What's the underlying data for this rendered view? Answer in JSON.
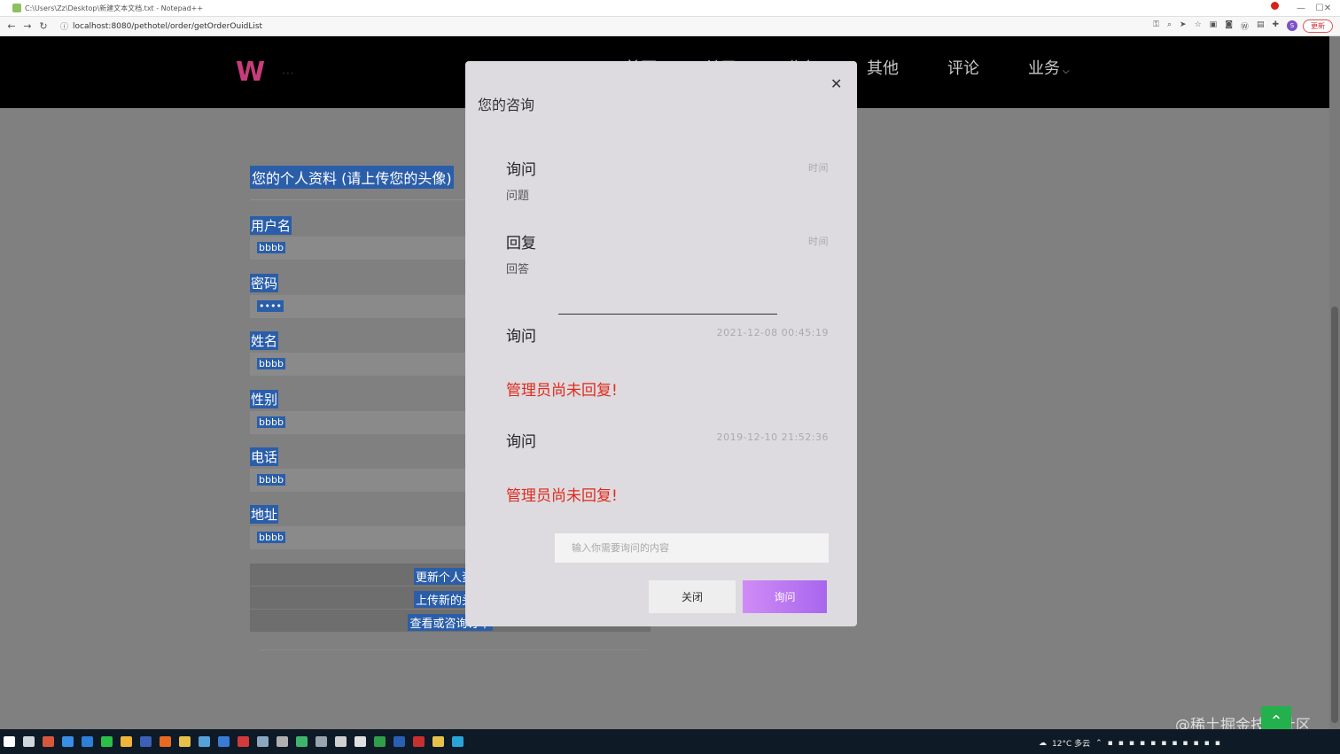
{
  "window": {
    "title": "C:\\Users\\Zz\\Desktop\\新建文本文档.txt - Notepad++",
    "minimize_icon": "minimize-icon",
    "maximize_icon": "maximize-icon",
    "close_icon": "close-icon"
  },
  "browser": {
    "url": "localhost:8080/pethotel/order/getOrderOuidList",
    "update_label": "更新",
    "profile_initial": "S"
  },
  "site": {
    "nav": [
      "首页",
      "关于",
      "业务",
      "其他",
      "评论",
      "业务"
    ]
  },
  "profile": {
    "title": "您的个人资料 (请上传您的头像)",
    "fields": [
      {
        "label": "用户名",
        "value": "bbbb"
      },
      {
        "label": "密码",
        "value": "••••"
      },
      {
        "label": "姓名",
        "value": "bbbb"
      },
      {
        "label": "性别",
        "value": "bbbb"
      },
      {
        "label": "电话",
        "value": "bbbb"
      },
      {
        "label": "地址",
        "value": "bbbb"
      }
    ],
    "buttons": [
      "更新个人资料",
      "上传新的头像",
      "查看或咨询订单"
    ]
  },
  "modal": {
    "title": "您的咨询",
    "header": {
      "ask_label": "询问",
      "ask_time_label": "时间",
      "ask_body": "问题",
      "reply_label": "回复",
      "reply_time_label": "时间",
      "reply_body": "回答"
    },
    "inquiries": [
      {
        "label": "询问",
        "time": "2021-12-08 00:45:19",
        "reply": "管理员尚未回复!"
      },
      {
        "label": "询问",
        "time": "2019-12-10 21:52:36",
        "reply": "管理员尚未回复!"
      }
    ],
    "input_placeholder": "输入你需要询问的内容",
    "close_label": "关闭",
    "ask_label": "询问"
  },
  "watermark": "@稀土掘金技术社区",
  "taskbar": {
    "weather": "12°C 多云"
  },
  "colors": {
    "accent_purple": "#a866ee",
    "reply_red": "#e02a1c",
    "selection_blue": "#2b5ea8",
    "back_top_green": "#22b14c"
  }
}
